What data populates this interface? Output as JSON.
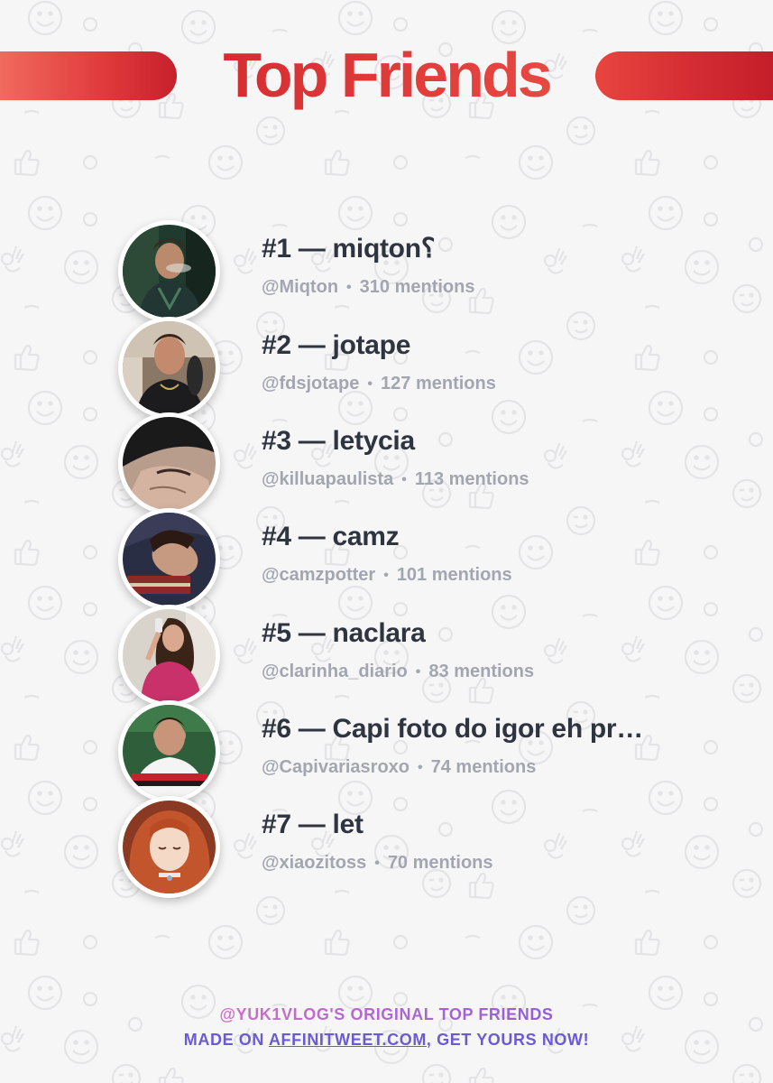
{
  "header": {
    "title": "Top Friends"
  },
  "friends": [
    {
      "name": "#1 — miqton⸮",
      "handle": "@Miqton",
      "mentions": "310 mentions"
    },
    {
      "name": "#2 — jotape",
      "handle": "@fdsjotape",
      "mentions": "127 mentions"
    },
    {
      "name": "#3 — letycia",
      "handle": "@killuapaulista",
      "mentions": "113 mentions"
    },
    {
      "name": "#4 — camz",
      "handle": "@camzpotter",
      "mentions": "101 mentions"
    },
    {
      "name": "#5 — naclara",
      "handle": "@clarinha_diario",
      "mentions": "83 mentions"
    },
    {
      "name": "#6 — Capi foto do igor eh pr…",
      "handle": "@Capivariasroxo",
      "mentions": "74 mentions"
    },
    {
      "name": "#7 — let",
      "handle": "@xiaozitoss",
      "mentions": "70 mentions"
    }
  ],
  "separator": "•",
  "footer": {
    "line1": "@YUK1VLOG'S ORIGINAL TOP FRIENDS",
    "line2_prefix": "MADE ON ",
    "link_text": "AFFINITWEET.COM",
    "line2_suffix": ", GET YOURS NOW!"
  },
  "colors": {
    "title_red": "#d0272f",
    "name_text": "#2e3440",
    "meta_text": "#a2a6b0",
    "footer_pink": "#c067c8",
    "footer_purple": "#6b5bd3"
  }
}
